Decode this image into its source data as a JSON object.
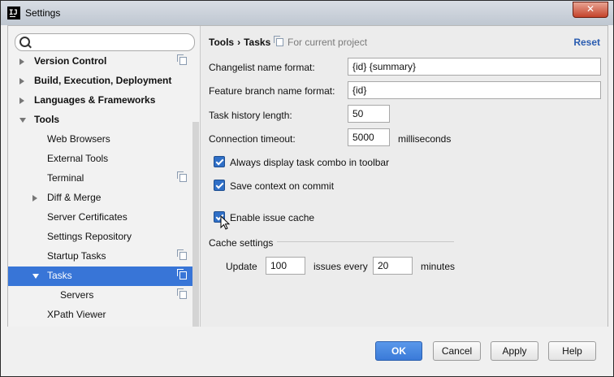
{
  "window": {
    "title": "Settings",
    "close_glyph": "✕"
  },
  "search": {
    "placeholder": "",
    "value": ""
  },
  "tree": {
    "items": [
      {
        "label": "Version Control",
        "bold": true,
        "arrow": "right",
        "copy": true
      },
      {
        "label": "Build, Execution, Deployment",
        "bold": true,
        "arrow": "right",
        "copy": false
      },
      {
        "label": "Languages & Frameworks",
        "bold": true,
        "arrow": "right",
        "copy": false
      },
      {
        "label": "Tools",
        "bold": true,
        "arrow": "down",
        "copy": false
      },
      {
        "label": "Web Browsers",
        "bold": false,
        "arrow": "",
        "copy": false
      },
      {
        "label": "External Tools",
        "bold": false,
        "arrow": "",
        "copy": false
      },
      {
        "label": "Terminal",
        "bold": false,
        "arrow": "",
        "copy": true
      },
      {
        "label": "Diff & Merge",
        "bold": false,
        "arrow": "right",
        "copy": false
      },
      {
        "label": "Server Certificates",
        "bold": false,
        "arrow": "",
        "copy": false
      },
      {
        "label": "Settings Repository",
        "bold": false,
        "arrow": "",
        "copy": false
      },
      {
        "label": "Startup Tasks",
        "bold": false,
        "arrow": "",
        "copy": true
      },
      {
        "label": "Tasks",
        "bold": false,
        "arrow": "down",
        "copy": true,
        "selected": true
      },
      {
        "label": "Servers",
        "bold": false,
        "arrow": "",
        "copy": true
      },
      {
        "label": "XPath Viewer",
        "bold": false,
        "arrow": "",
        "copy": false
      }
    ]
  },
  "breadcrumb": {
    "parent": "Tools",
    "separator": "›",
    "current": "Tasks"
  },
  "scope_note": "For current project",
  "reset_label": "Reset",
  "form": {
    "changelist_label": "Changelist name format:",
    "changelist_value": "{id} {summary}",
    "branch_label": "Feature branch name format:",
    "branch_value": "{id}",
    "history_label": "Task history length:",
    "history_value": "50",
    "timeout_label": "Connection timeout:",
    "timeout_value": "5000",
    "timeout_unit": "milliseconds",
    "always_display_label": "Always display task combo in toolbar",
    "always_display_checked": true,
    "save_context_label": "Save context on commit",
    "save_context_checked": true,
    "enable_cache_label": "Enable issue cache",
    "enable_cache_checked": true,
    "cache_group_label": "Cache settings",
    "update_label": "Update",
    "update_value": "100",
    "issues_every_label": "issues every",
    "minutes_value": "20",
    "minutes_label": "minutes"
  },
  "buttons": {
    "ok": "OK",
    "cancel": "Cancel",
    "apply": "Apply",
    "help": "Help"
  },
  "colors": {
    "accent": "#3875d7",
    "link": "#2a5cb0",
    "close": "#c4432b"
  }
}
